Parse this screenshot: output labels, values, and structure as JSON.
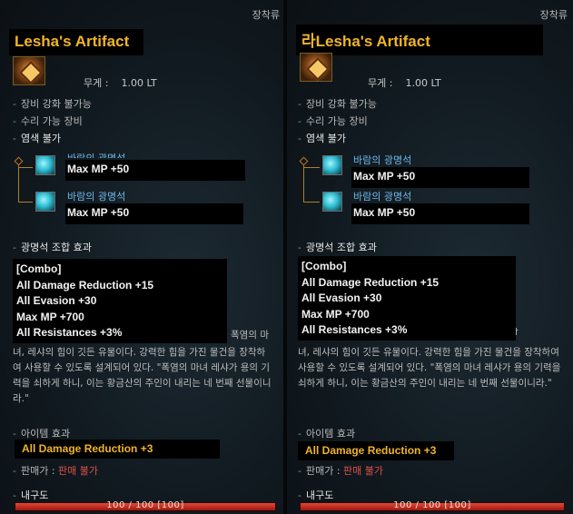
{
  "tooltips": [
    {
      "category": "장착류",
      "title": "Lesha's Artifact",
      "weight_label": "무게 :",
      "weight_value": "1.00 LT",
      "prop1": "장비 강화 불가능",
      "prop2": "수리 가능 장비",
      "prop3": "염색 불가",
      "gems": [
        {
          "name": "바람의 광명석",
          "effect": "Max MP +50"
        },
        {
          "name": "바람의 광명석",
          "effect": "Max MP +50"
        }
      ],
      "combo_header": "광명석 조합 효과",
      "combo_lines": [
        "[Combo]",
        "All Damage Reduction +15",
        "All Evasion +30",
        "Max MP +700",
        "All Resistances +3%"
      ],
      "desc_tail": "폭염의 마",
      "desc": "녀, 레샤의 힘이 깃든 유물이다. 강력한 힘을 가진 물건을 장착하여 사용할 수 있도록 설계되어 있다. \"폭염의 마녀 레샤가 용의 기력을 쇠하게 하니, 이는 황금산의 주인이 내리는 네 번째 선물이니라.\"",
      "item_effect_header": "아이템 효과",
      "item_effect": "All Damage Reduction +3",
      "price_label": "판매가 :",
      "price_value": "판매 불가",
      "durability_label": "내구도",
      "durability_text": "100 / 100 [100]",
      "durability_fraction": 1.0
    },
    {
      "category": "장착류",
      "title": "Lesha's Artifact",
      "title_prefix": "라",
      "weight_label": "무게 :",
      "weight_value": "1.00 LT",
      "prop1": "장비 강화 불가능",
      "prop2": "수리 가능 장비",
      "prop3": "염색 불가",
      "gems": [
        {
          "name": "바람의 광명석",
          "effect": "Max MP +50"
        },
        {
          "name": "바람의 광명석",
          "effect": "Max MP +50"
        }
      ],
      "combo_header": "광명석 조합 효과",
      "combo_lines": [
        "[Combo]",
        "All Damage Reduction +15",
        "All Evasion +30",
        "Max MP +700",
        "All Resistances +3%"
      ],
      "desc_head": "설명 : 나스테시가의 첫 번째 축음에서 내어진 폭염의 마",
      "desc": "녀, 레샤의 힘이 깃든 유물이다. 강력한 힘을 가진 물건을 장착하여 사용할 수 있도록 설계되어 있다. \"폭염의 마녀 레샤가 용의 기력을 쇠하게 하니, 이는 황금산의 주인이 내리는 네 번째 선물이니라.\"",
      "item_effect_header": "아이템 효과",
      "item_effect": "All Damage Reduction +3",
      "price_label": "판매가 :",
      "price_value": "판매 불가",
      "durability_label": "내구도",
      "durability_text": "100 / 100 [100]",
      "durability_fraction": 1.0
    }
  ]
}
